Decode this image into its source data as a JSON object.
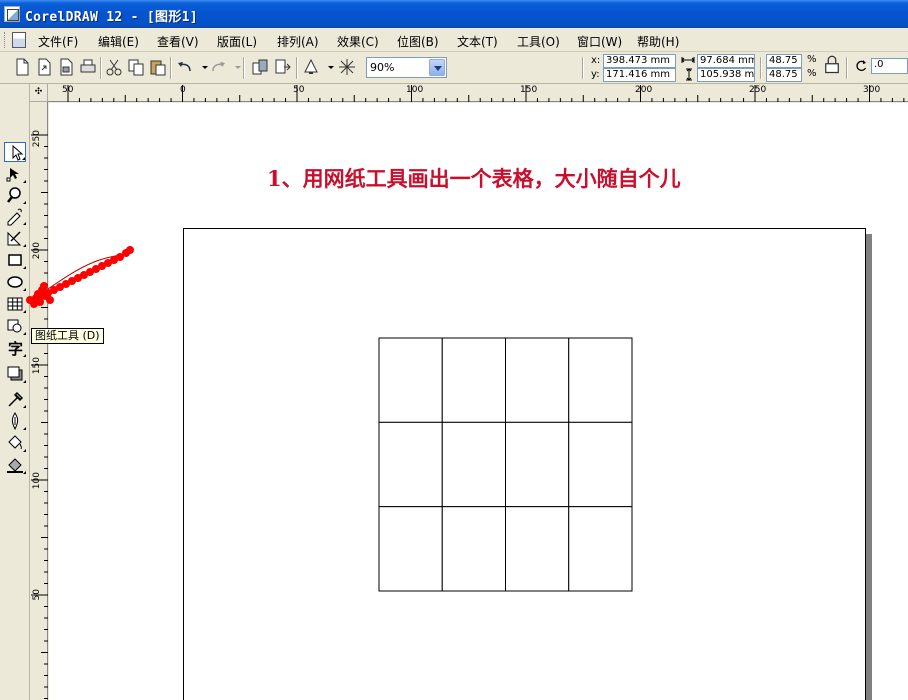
{
  "window": {
    "title": "CorelDRAW 12 - [图形1]"
  },
  "menu": [
    "文件(F)",
    "编辑(E)",
    "查看(V)",
    "版面(L)",
    "排列(A)",
    "效果(C)",
    "位图(B)",
    "文本(T)",
    "工具(O)",
    "窗口(W)",
    "帮助(H)"
  ],
  "toolbar": {
    "zoom": "90%",
    "x_label": "x:",
    "y_label": "y:",
    "x_value": "398.473 mm",
    "y_value": "171.416 mm",
    "width_value": "97.684 mm",
    "height_value": "105.938 mm",
    "scale_x": "48.75",
    "scale_y": "48.75",
    "percent": "%",
    "rotation": ".0"
  },
  "ruler": {
    "horizontal": [
      "50",
      "0",
      "50",
      "100",
      "150",
      "200",
      "250",
      "300"
    ],
    "vertical": [
      "250",
      "200",
      "150",
      "100",
      "50"
    ]
  },
  "tooltip": "图纸工具 (D)",
  "canvas": {
    "instruction": "1、用网纸工具画出一个表格，大小随自个儿"
  },
  "graph_paper": {
    "rows": 3,
    "columns": 4
  },
  "icons": {
    "tools": [
      "pick-tool-icon",
      "shape-tool-icon",
      "zoom-tool-icon",
      "freehand-tool-icon",
      "smart-fill-icon",
      "rectangle-tool-icon",
      "ellipse-tool-icon",
      "graph-paper-tool-icon",
      "basic-shapes-icon",
      "text-tool-icon",
      "interactive-tool-icon",
      "eyedropper-icon",
      "outline-tool-icon",
      "fill-tool-icon",
      "interactive-fill-icon"
    ]
  },
  "colors": {
    "instruction": "#c8102e",
    "annotation": "#ff0000"
  }
}
